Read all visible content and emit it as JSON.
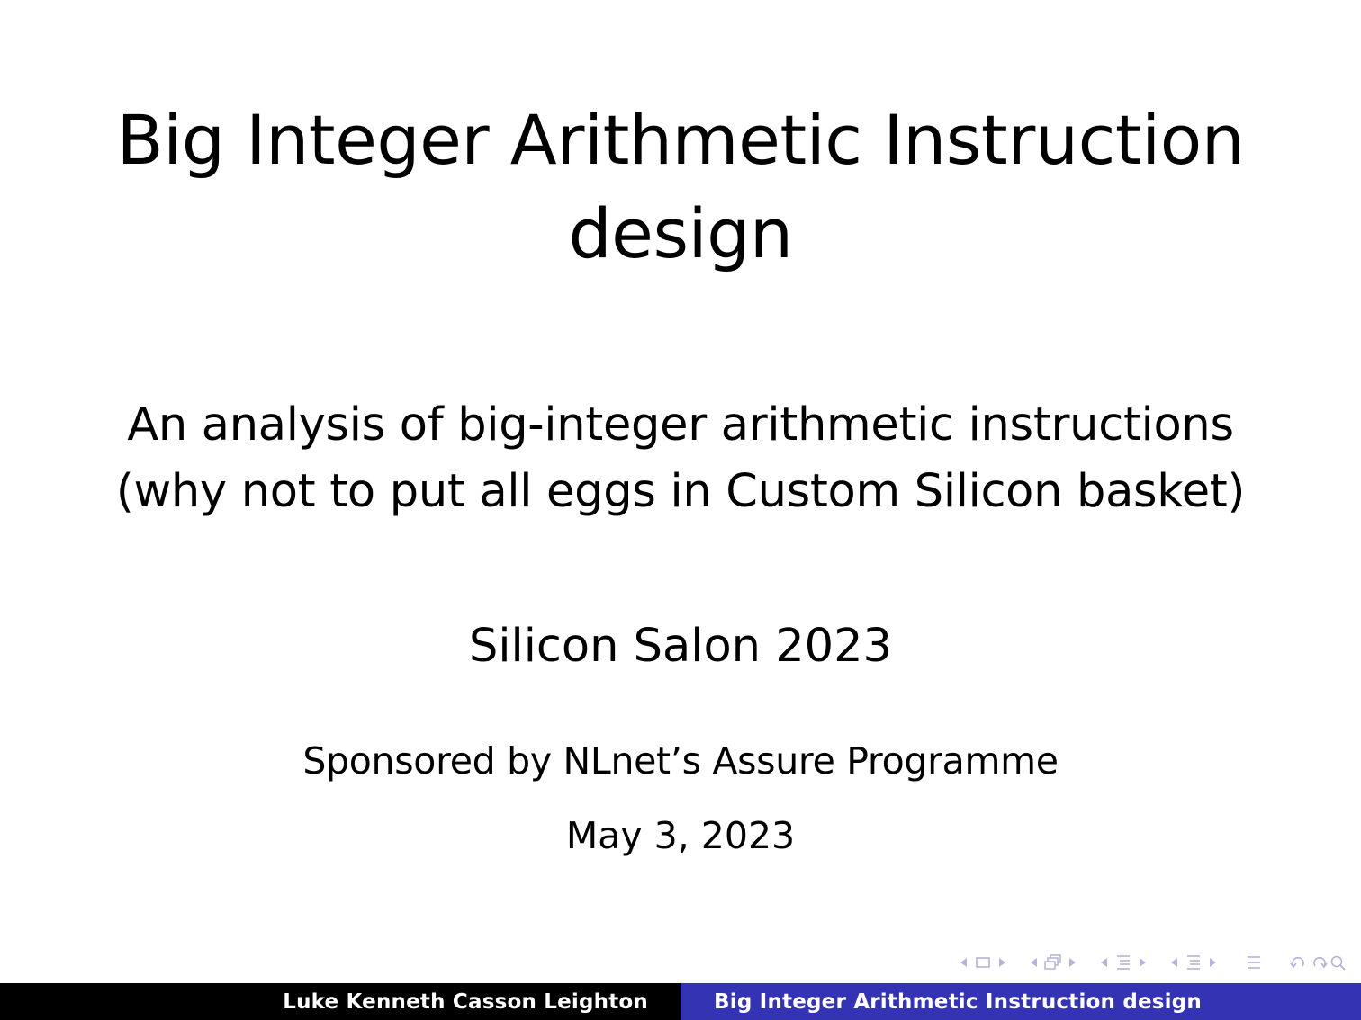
{
  "slide": {
    "title_line1": "Big Integer Arithmetic Instruction",
    "title_line2": "design",
    "subtitle_line1": "An analysis of big-integer arithmetic instructions",
    "subtitle_line2": "(why not to put all eggs in Custom Silicon basket)",
    "event": "Silicon Salon 2023",
    "sponsor": "Sponsored by NLnet’s Assure Programme",
    "date": "May 3, 2023"
  },
  "footer": {
    "author": "Luke Kenneth Casson Leighton",
    "short_title": "Big Integer Arithmetic Instruction design"
  },
  "navigation": {
    "icons": [
      "frame-icon",
      "subsection-icon",
      "section-icon",
      "document-icon",
      "align-icon",
      "search-icon"
    ]
  },
  "colors": {
    "footer_left_bg": "#000000",
    "footer_right_bg": "#3333b3",
    "nav_symbol": "#b4b4d8"
  }
}
